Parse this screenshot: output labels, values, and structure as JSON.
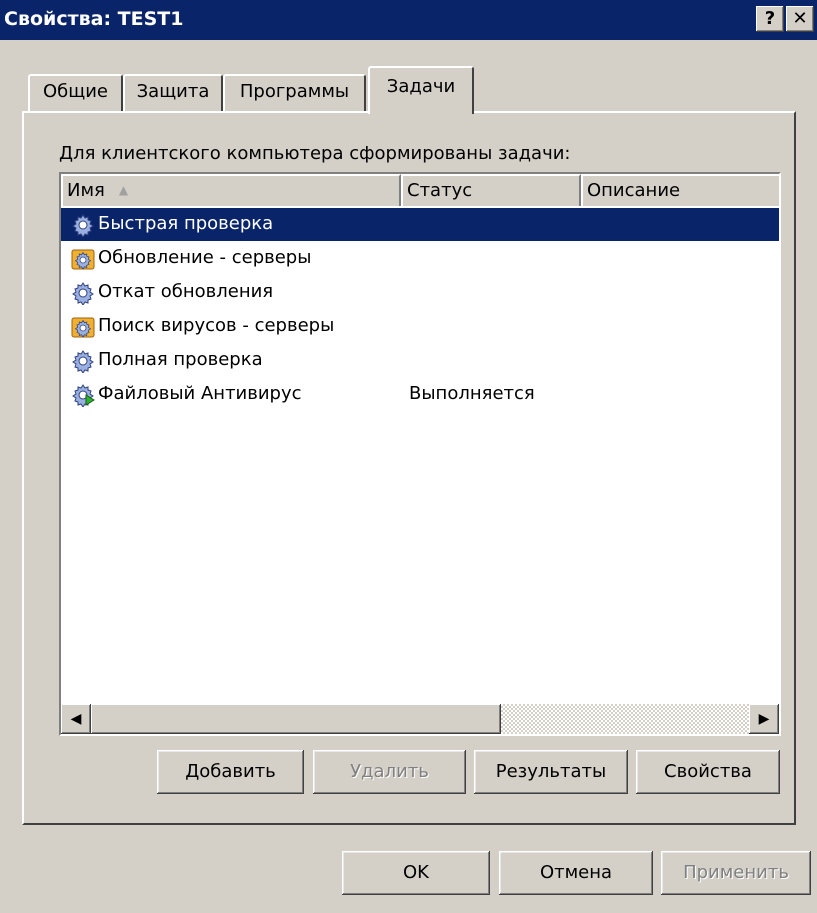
{
  "window": {
    "title": "Свойства: TEST1",
    "help_label": "?",
    "close_label": "✕"
  },
  "tabs": [
    {
      "label": "Общие",
      "active": false
    },
    {
      "label": "Защита",
      "active": false
    },
    {
      "label": "Программы",
      "active": false
    },
    {
      "label": "Задачи",
      "active": true
    }
  ],
  "prompt": "Для клиентского компьютера сформированы задачи:",
  "columns": [
    "Имя",
    "Статус",
    "Описание"
  ],
  "sort_indicator": "▲",
  "tasks": [
    {
      "name": "Быстрая проверка",
      "status": "",
      "icon": "gear-icon",
      "selected": true
    },
    {
      "name": "Обновление - серверы",
      "status": "",
      "icon": "group-gear-icon",
      "selected": false
    },
    {
      "name": "Откат обновления",
      "status": "",
      "icon": "gear-icon",
      "selected": false
    },
    {
      "name": "Поиск вирусов - серверы",
      "status": "",
      "icon": "group-gear-icon",
      "selected": false
    },
    {
      "name": "Полная проверка",
      "status": "",
      "icon": "gear-icon",
      "selected": false
    },
    {
      "name": "Файловый Антивирус",
      "status": "Выполняется",
      "icon": "running-gear-icon",
      "selected": false
    }
  ],
  "scrollbar": {
    "left": "◀",
    "right": "▶"
  },
  "task_buttons": {
    "add": "Добавить",
    "delete": "Удалить",
    "results": "Результаты",
    "properties": "Свойства"
  },
  "dialog_buttons": {
    "ok": "OK",
    "cancel": "Отмена",
    "apply": "Применить"
  },
  "colors": {
    "title_bar": "#0a246a",
    "face": "#d4d0c8",
    "selection": "#0a246a"
  }
}
